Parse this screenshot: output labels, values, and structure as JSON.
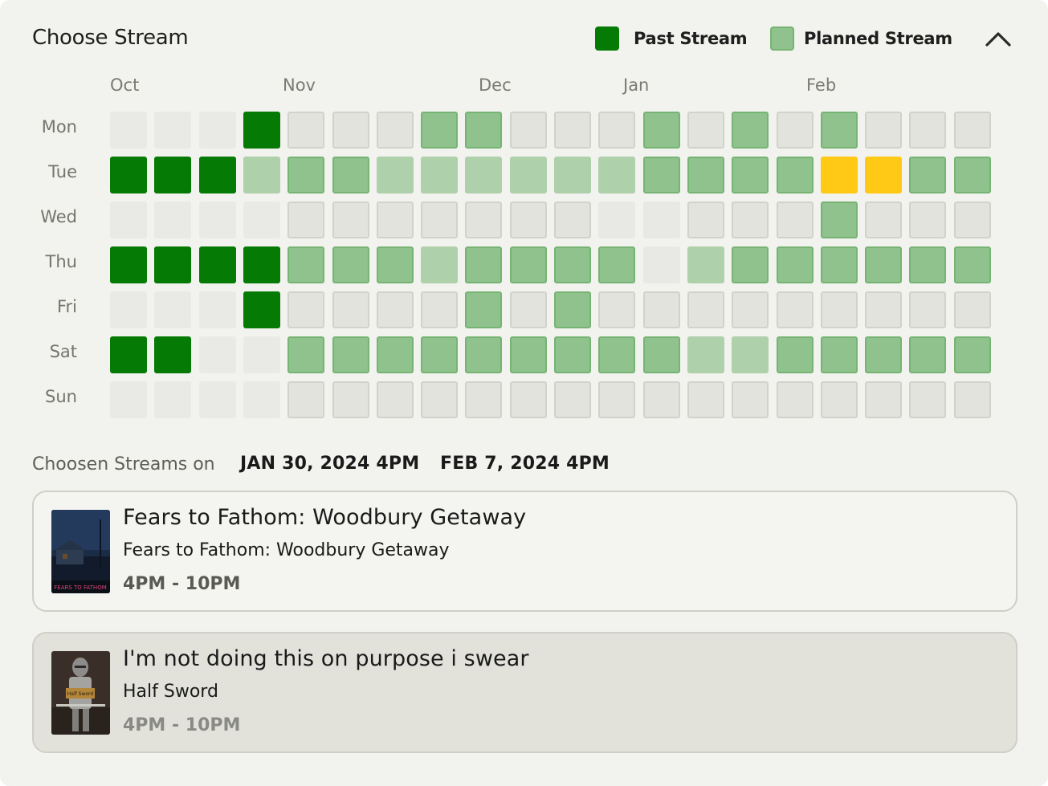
{
  "header": {
    "title": "Choose Stream",
    "legend": [
      {
        "label": "Past Stream",
        "color": "#057a05"
      },
      {
        "label": "Planned Stream",
        "color": "#8fc28d"
      }
    ],
    "collapse_icon": "chevron-up-icon"
  },
  "calendar": {
    "months": [
      "Oct",
      "Nov",
      "Dec",
      "Jan",
      "Feb"
    ],
    "days": [
      "Mon",
      "Tue",
      "Wed",
      "Thu",
      "Fri",
      "Sat",
      "Sun"
    ],
    "week_count": 20,
    "colors": {
      "past": "#057a05",
      "planned": "#8fc28d",
      "planned_light": "#aed0aa",
      "selected": "#ffc915",
      "empty": "#e3e3de",
      "inactive": "#e9e9e5"
    },
    "legend_codes": "n = inactive, e = empty, p = past stream, m = planned stream, l = planned (light), y = selected, f = faded",
    "rows": [
      "nnnpeeemmeeemememeee",
      "ppplmmllllllmmmmyymmm",
      "nnnneeeeeeeffeeemeee",
      "ppppmmmlmmmmflmmmmmm",
      "nnnpeeeememeeeeeeeee",
      "ppnnmmmmmmmmmllmmmmm",
      "nnnneeeeeeeeeeeeeeee"
    ]
  },
  "chosen": {
    "label": "Choosen Streams on",
    "dates": [
      "JAN 30, 2024 4PM",
      "FEB 7, 2024 4PM"
    ]
  },
  "streams": [
    {
      "title": "Fears to Fathom: Woodbury Getaway",
      "game": "Fears to Fathom: Woodbury Getaway",
      "time": "4PM - 10PM",
      "thumbnail_text": "FEARS TO FATHOM"
    },
    {
      "title": "I'm not doing this on purpose i swear",
      "game": "Half Sword",
      "time": "4PM - 10PM",
      "thumbnail_text": "Half Sword"
    }
  ]
}
